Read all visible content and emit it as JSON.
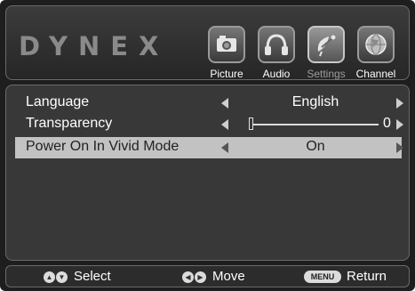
{
  "brand": "DYNEX",
  "tabs": [
    {
      "label": "Picture",
      "icon": "camera-icon",
      "active": false
    },
    {
      "label": "Audio",
      "icon": "headphones-icon",
      "active": false
    },
    {
      "label": "Settings",
      "icon": "satellite-dish-icon",
      "active": true
    },
    {
      "label": "Channel",
      "icon": "globe-icon",
      "active": false
    }
  ],
  "settings": {
    "rows": [
      {
        "label": "Language",
        "value": "English"
      },
      {
        "label": "Transparency",
        "value": "0",
        "slider_fraction": 0
      },
      {
        "label": "Power On In Vivid Mode",
        "value": "On",
        "selected": true
      }
    ]
  },
  "footer": {
    "select": {
      "label": "Select",
      "icon": "up-down-buttons-icon"
    },
    "move": {
      "label": "Move",
      "icon": "left-right-buttons-icon"
    },
    "return": {
      "label": "Return",
      "key": "MENU"
    }
  },
  "colors": {
    "background": "#1e1e1e",
    "panel": "#383838",
    "selected_row": "#c2c2c2",
    "active_tab_label": "#9d9d9d"
  }
}
